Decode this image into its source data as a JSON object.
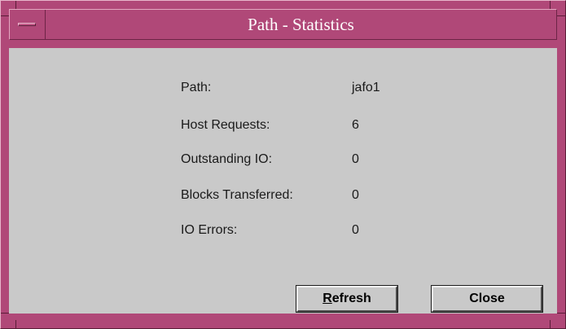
{
  "window": {
    "title": "Path - Statistics"
  },
  "stats": [
    {
      "label": "Path:",
      "value": "jafo1"
    },
    {
      "label": "Host Requests:",
      "value": "6"
    },
    {
      "label": "Outstanding IO:",
      "value": "0"
    },
    {
      "label": "Blocks Transferred:",
      "value": "0"
    },
    {
      "label": "IO Errors:",
      "value": "0"
    }
  ],
  "buttons": {
    "refresh_mnemonic": "R",
    "refresh_rest": "efresh",
    "close_label": "Close"
  },
  "icons": {
    "window_menu": "window-menu-icon"
  },
  "colors": {
    "titlebar": "#b04878",
    "panel": "#c9c9c9",
    "title_text": "#ffffff"
  }
}
